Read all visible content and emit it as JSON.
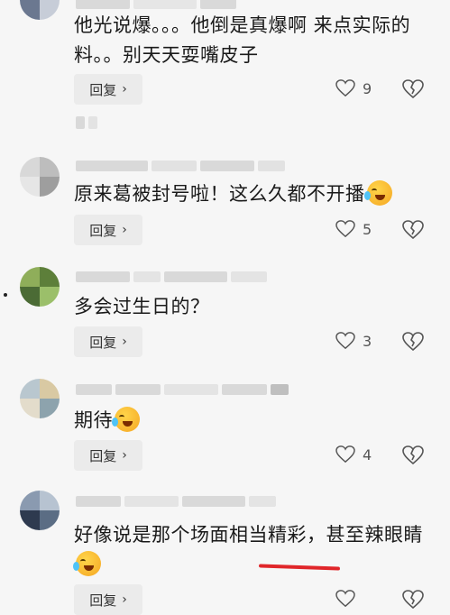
{
  "comments": [
    {
      "text": "他光说爆。。。他倒是真爆啊 来点实际的料。。别天天耍嘴皮子",
      "reply_label": "回复",
      "likes": "9",
      "has_emoji": false
    },
    {
      "text": "原来葛被封号啦！这么久都不开播",
      "reply_label": "回复",
      "likes": "5",
      "has_emoji": true
    },
    {
      "text": "多会过生日的？",
      "reply_label": "回复",
      "likes": "3",
      "has_emoji": false
    },
    {
      "text": "期待",
      "reply_label": "回复",
      "likes": "4",
      "has_emoji": true
    },
    {
      "text": "好像说是那个场面相当精彩，甚至辣眼睛",
      "reply_label": "回复",
      "likes": "",
      "has_emoji": true
    }
  ],
  "colors": {
    "background": "#f6f6f6",
    "reply_bg": "#ebebeb",
    "highlight": "#e0262a"
  },
  "icons": [
    "heart-icon",
    "broken-heart-icon",
    "chevron-right-icon",
    "laugh-cry-emoji"
  ]
}
